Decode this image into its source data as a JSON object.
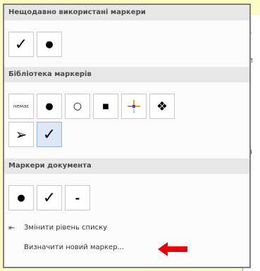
{
  "recent": {
    "title": "Нещодавно використані маркери",
    "items": [
      "✓",
      "●"
    ]
  },
  "library": {
    "title": "Бібліотека маркерів",
    "none_label": "немає",
    "items": [
      "●",
      "○",
      "■",
      "❖",
      "➢",
      "✓"
    ]
  },
  "document": {
    "title": "Маркери документа",
    "items": [
      "●",
      "✓",
      "-"
    ]
  },
  "menu": {
    "change_level": "Змінити рівень списку",
    "define_new": "Визначити новий маркер..."
  },
  "colors": {
    "arrow": "#e8000b",
    "selected": "#dce8f6"
  }
}
